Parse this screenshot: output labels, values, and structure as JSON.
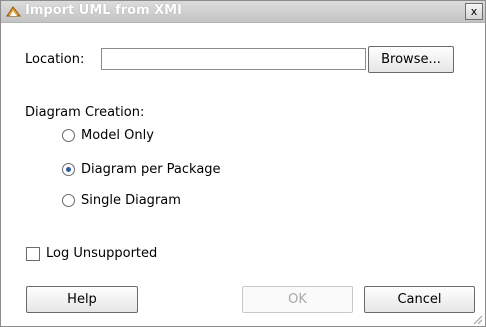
{
  "window": {
    "title": "Import UML from XMI",
    "close_label": "x"
  },
  "location": {
    "label": "Location:",
    "value": "",
    "browse_label": "Browse..."
  },
  "diagram_creation": {
    "label": "Diagram Creation:",
    "options": [
      {
        "label": "Model Only",
        "checked": false
      },
      {
        "label": "Diagram per Package",
        "checked": true
      },
      {
        "label": "Single Diagram",
        "checked": false
      }
    ]
  },
  "log_unsupported": {
    "label": "Log Unsupported",
    "checked": false
  },
  "buttons": {
    "help": "Help",
    "ok": "OK",
    "cancel": "Cancel"
  },
  "icons": {
    "app": "import-icon",
    "close": "close-icon",
    "resize": "resize-grip-icon"
  },
  "colors": {
    "titlebar": "#c8c8c8",
    "radio_selected": "#2d5aa0",
    "disabled_text": "#a8a8a8"
  }
}
